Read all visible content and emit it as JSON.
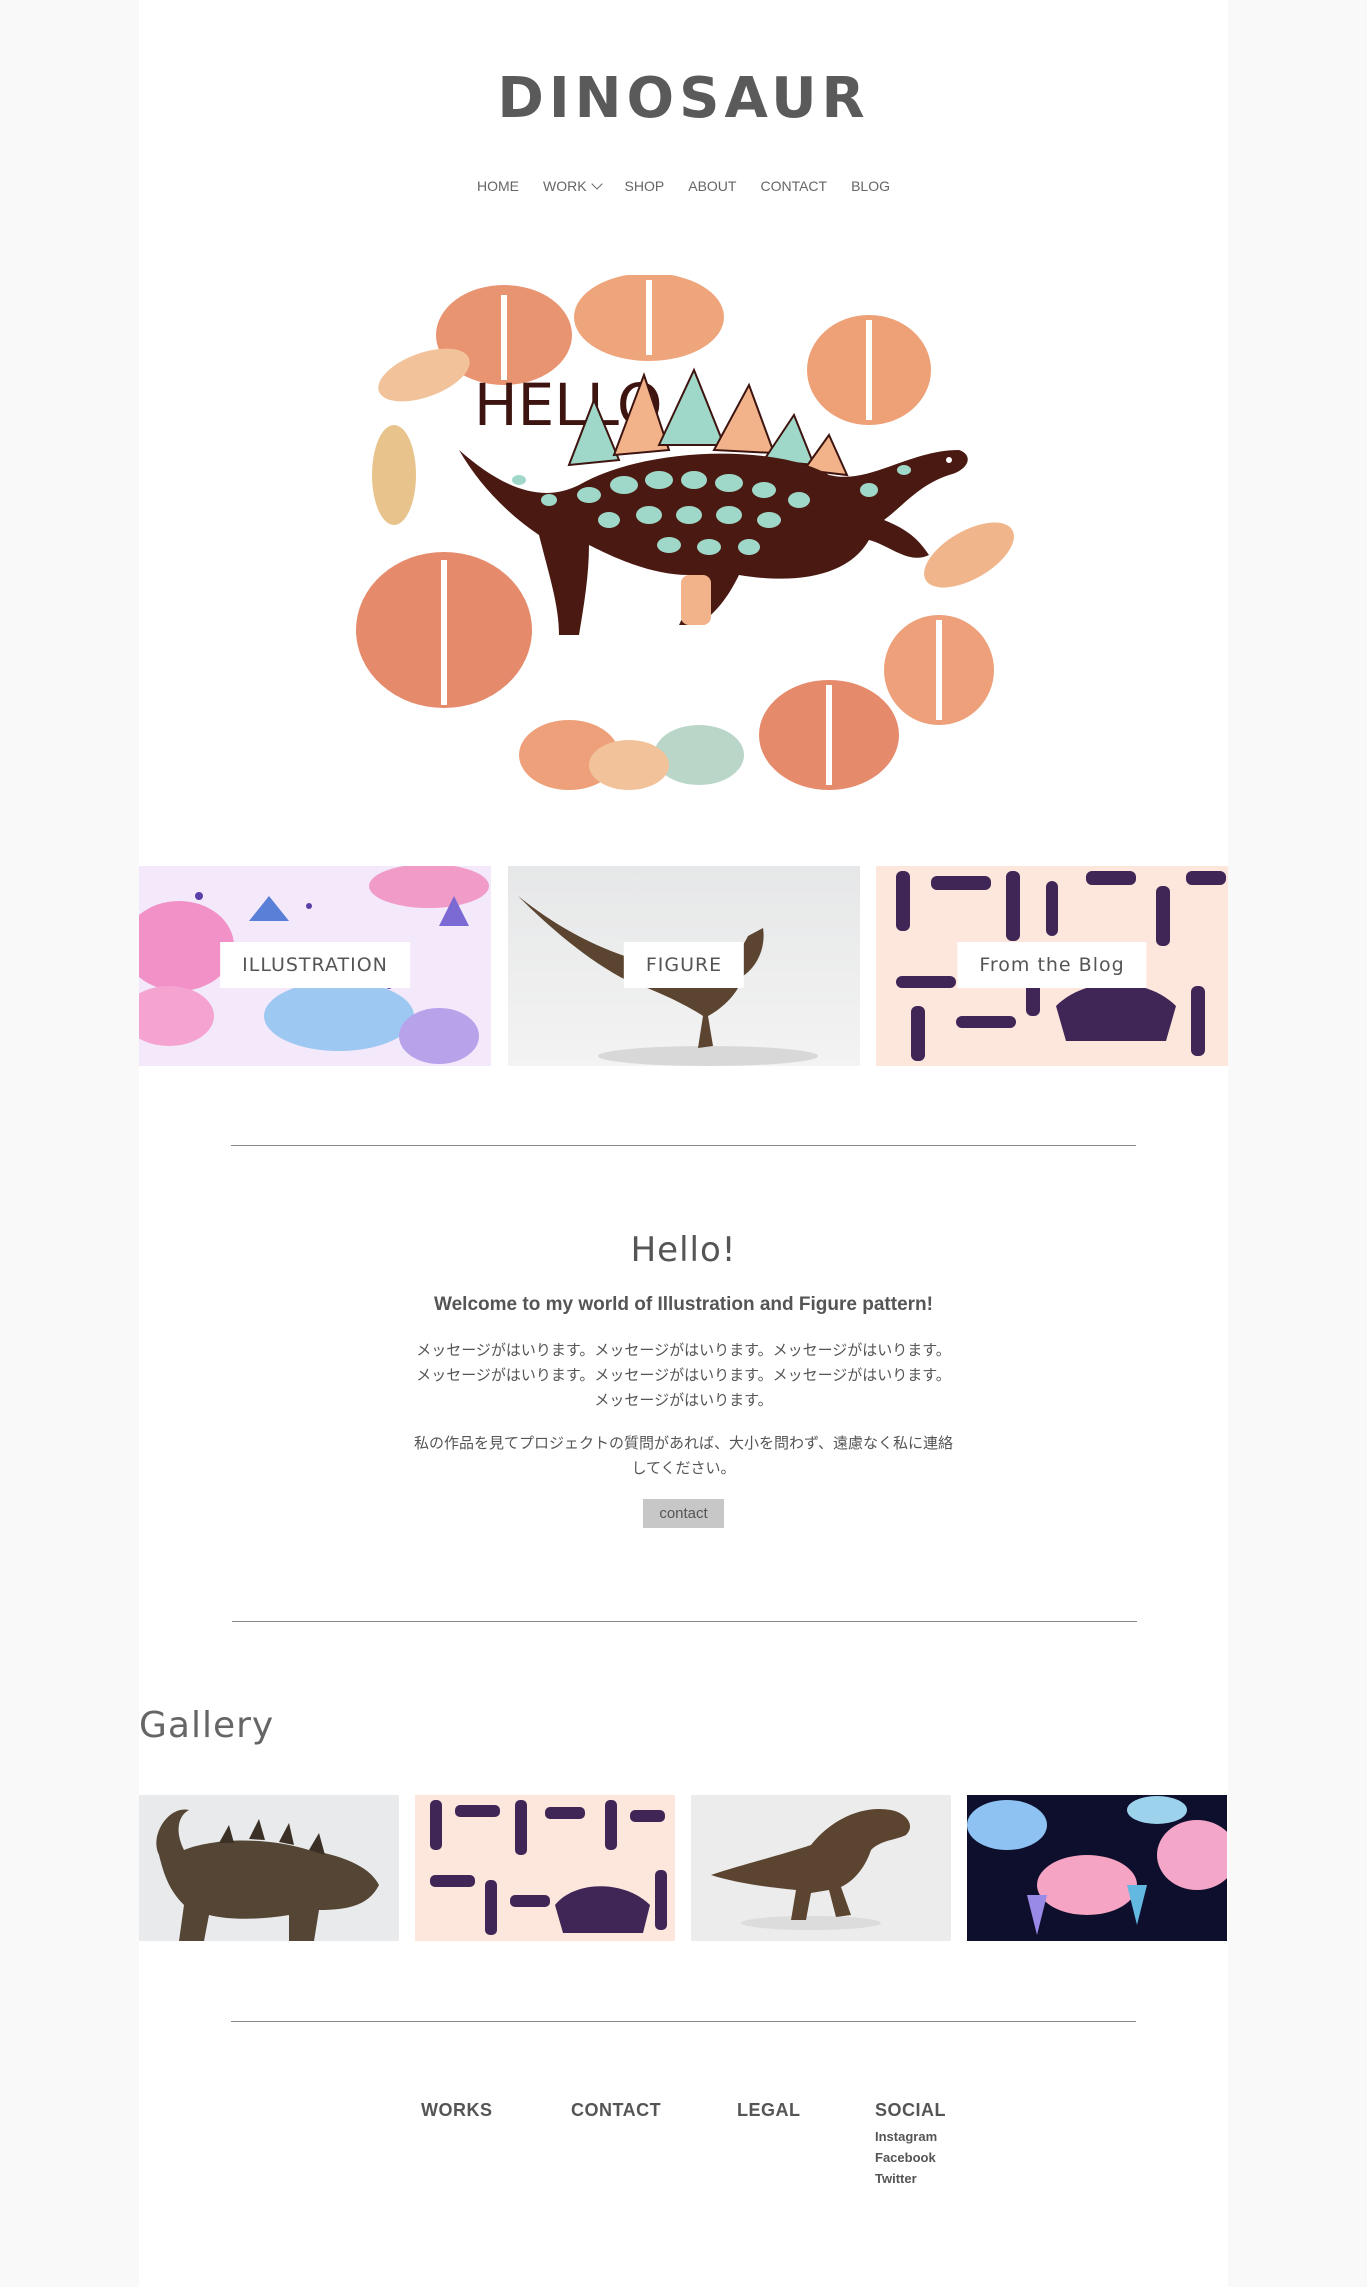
{
  "site": {
    "logo": "DINOSAUR"
  },
  "nav": {
    "items": [
      {
        "label": "HOME"
      },
      {
        "label": "WORK",
        "has_dropdown": true
      },
      {
        "label": "SHOP"
      },
      {
        "label": "ABOUT"
      },
      {
        "label": "CONTACT"
      },
      {
        "label": "BLOG"
      }
    ]
  },
  "hero": {
    "text": "HELLO"
  },
  "cards": [
    {
      "label": "ILLUSTRATION"
    },
    {
      "label": "FIGURE"
    },
    {
      "label": "From the Blog"
    }
  ],
  "welcome": {
    "title": "Hello!",
    "subtitle": "Welcome to my world of Illustration and Figure pattern!",
    "message1": "メッセージがはいります。メッセージがはいります。メッセージがはいります。メッセージがはいります。メッセージがはいります。メッセージがはいります。メッセージがはいります。",
    "message2": "私の作品を見てプロジェクトの質問があれば、大小を問わず、遠慮なく私に連絡してください。",
    "button": "contact"
  },
  "gallery": {
    "title": "Gallery"
  },
  "footer": {
    "works": "WORKS",
    "contact": "CONTACT",
    "legal": "LEGAL",
    "social": "SOCIAL",
    "social_links": [
      "Instagram",
      "Facebook",
      "Twitter"
    ]
  },
  "colors": {
    "page_bg": "#f9f9f9",
    "content_bg": "#ffffff",
    "text": "#555555",
    "button_bg": "#c7c7c7",
    "illustration_bg": "#f3e9fb",
    "figure_bg": "#ececed",
    "blog_bg": "#fde6dc",
    "bone_purple": "#3f2656",
    "leaf_orange": "#e8906e",
    "stego_brown": "#4a1a12",
    "stego_spot": "#9fd8c8"
  }
}
